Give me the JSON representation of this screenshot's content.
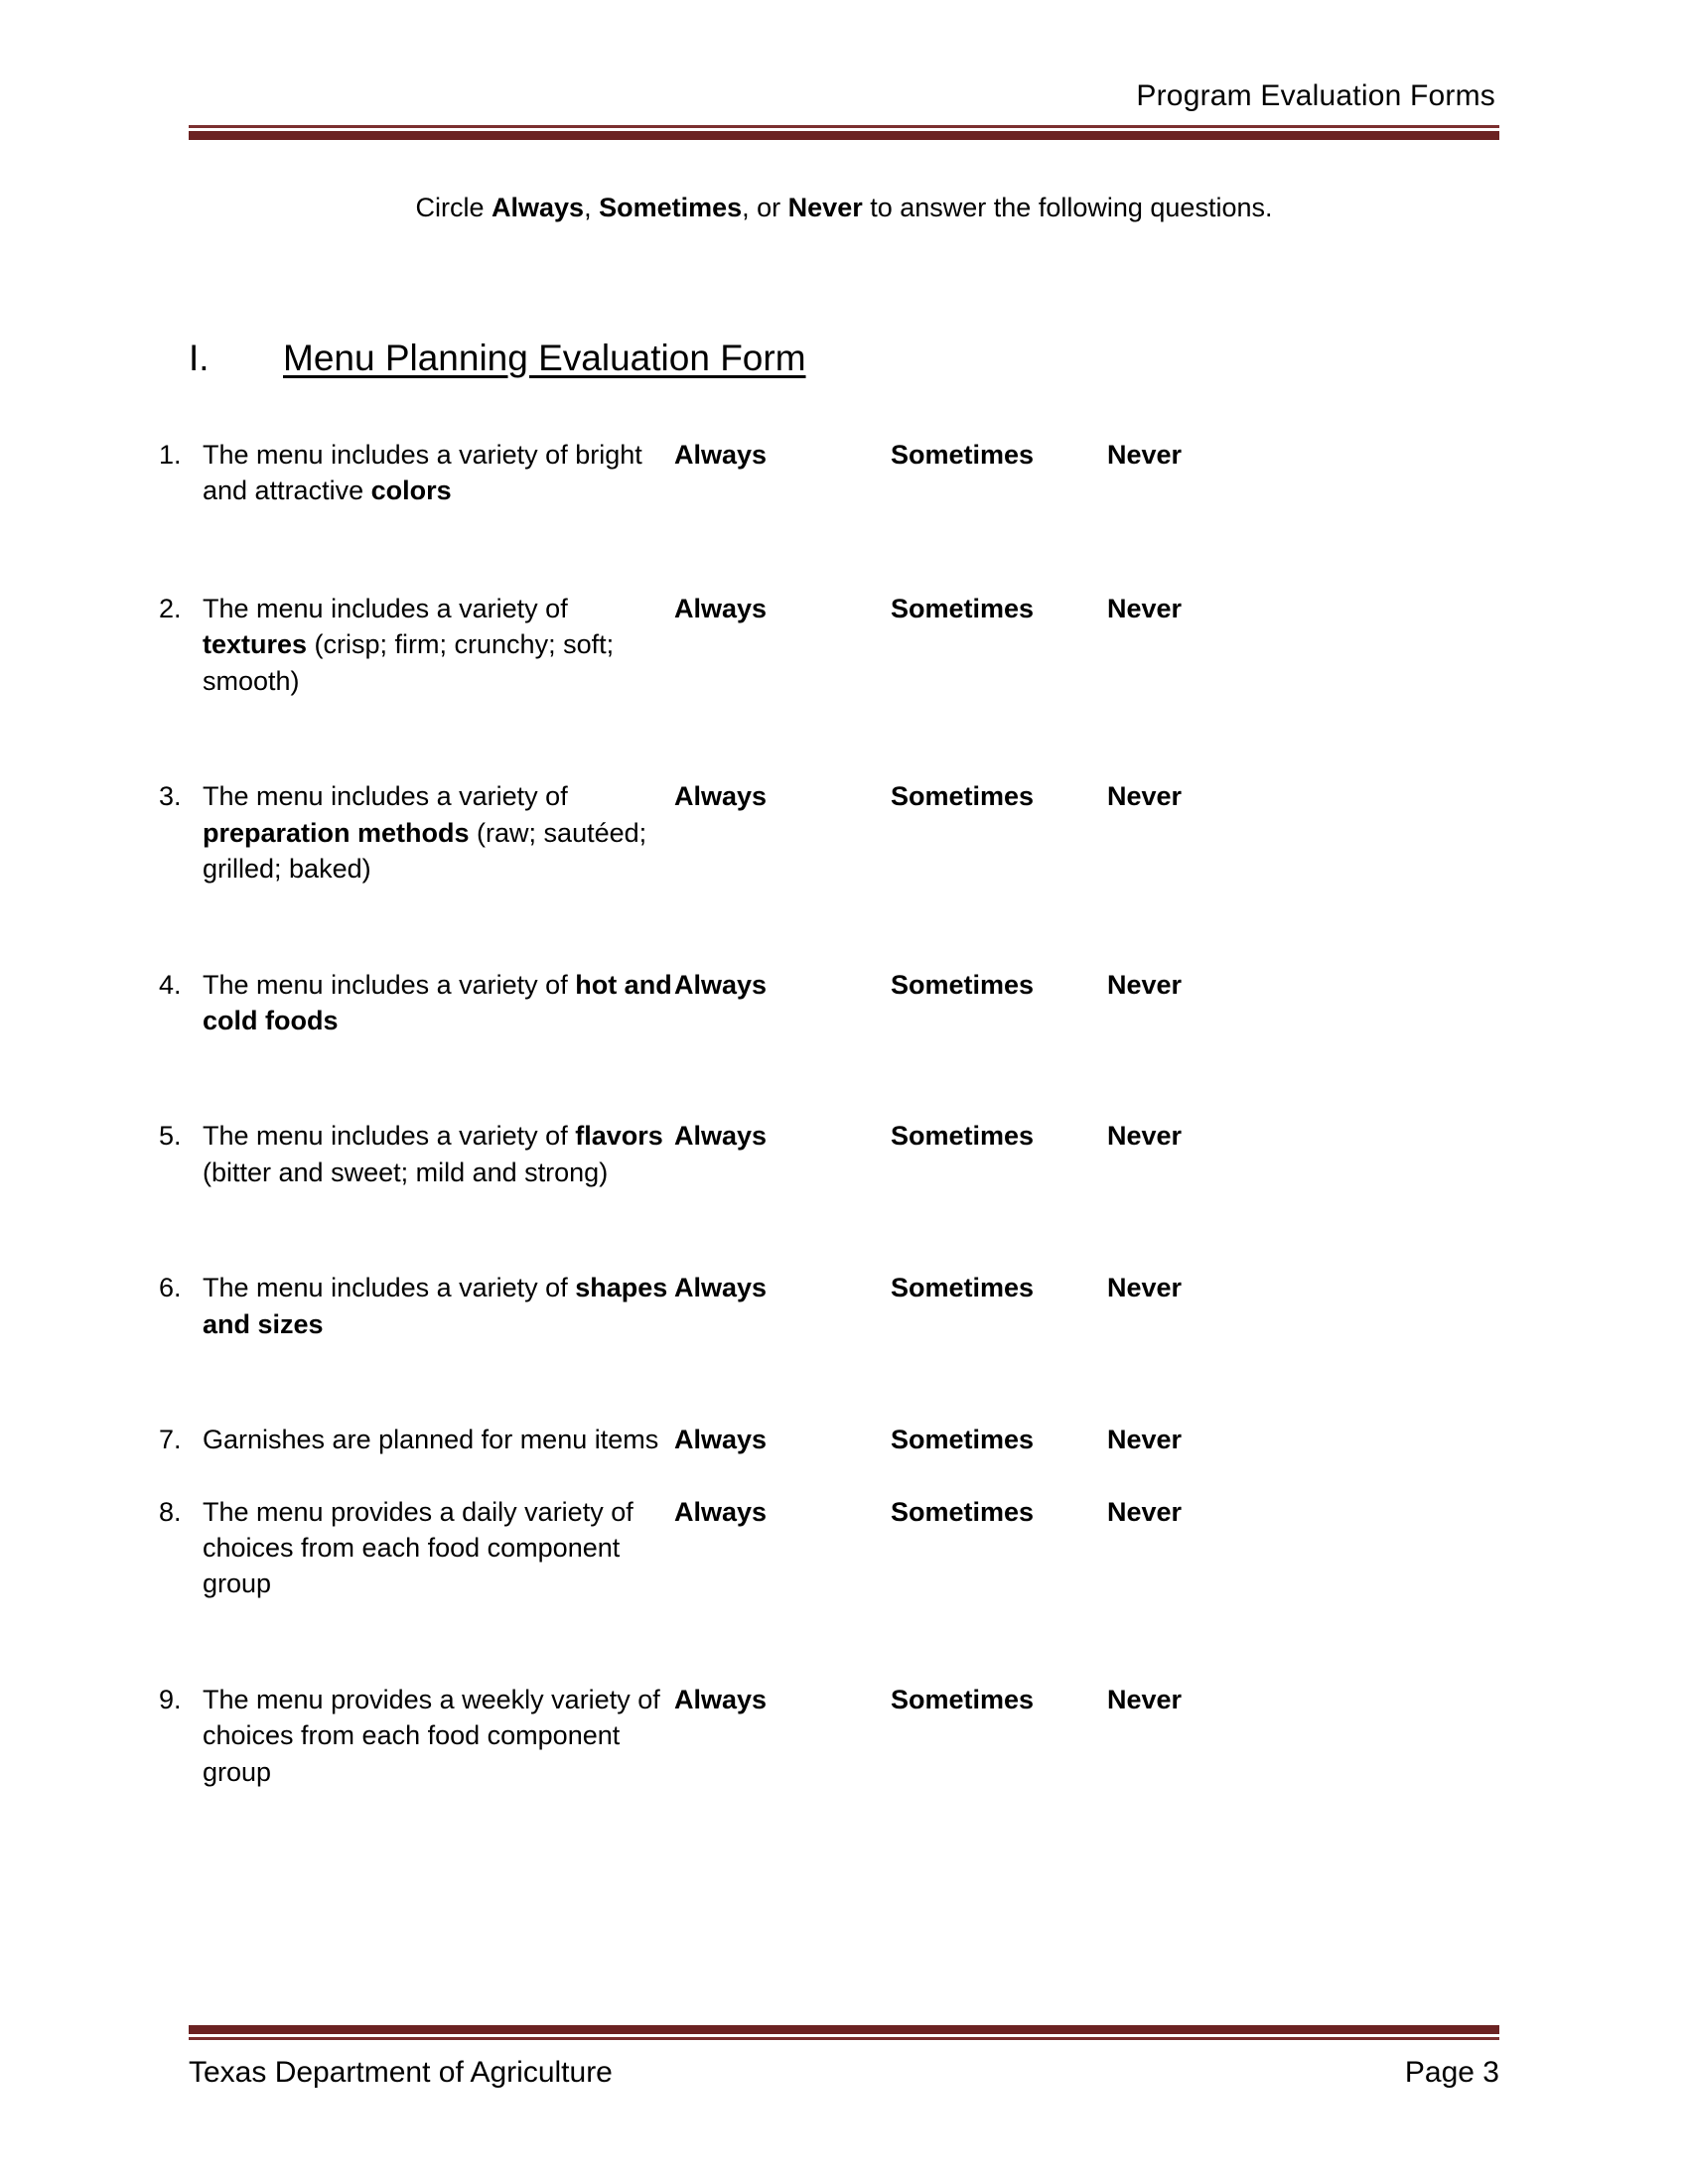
{
  "header": {
    "title": "Program Evaluation Forms"
  },
  "instruction": {
    "before": "Circle ",
    "opt1": "Always",
    "sep1": ", ",
    "opt2": "Sometimes",
    "sep2": ", or ",
    "opt3": "Never",
    "after": " to answer the following questions."
  },
  "section": {
    "number": "I.",
    "title": "Menu Planning Evaluation Form"
  },
  "options": {
    "always": "Always",
    "sometimes": "Sometimes",
    "never": "Never"
  },
  "questions": [
    {
      "number": "1.",
      "parts": [
        {
          "text": "The menu includes a variety of bright and attractive ",
          "bold": false
        },
        {
          "text": "colors",
          "bold": true
        }
      ],
      "plain": "The menu includes a variety of bright and attractive colors"
    },
    {
      "number": "2.",
      "parts": [
        {
          "text": "The menu includes a variety of ",
          "bold": false
        },
        {
          "text": "textures",
          "bold": true
        },
        {
          "text": " (crisp; firm; crunchy; soft; smooth)",
          "bold": false
        }
      ],
      "plain": "The menu includes a variety of textures (crisp; firm; crunchy; soft; smooth)"
    },
    {
      "number": "3.",
      "parts": [
        {
          "text": "The menu includes a variety of ",
          "bold": false
        },
        {
          "text": "preparation methods",
          "bold": true
        },
        {
          "text": " (raw; sautéed; grilled; baked)",
          "bold": false
        }
      ],
      "plain": "The menu includes a variety of preparation methods (raw; sautéed; grilled; baked)"
    },
    {
      "number": "4.",
      "parts": [
        {
          "text": "The menu includes a variety of ",
          "bold": false
        },
        {
          "text": "hot and cold foods",
          "bold": true
        }
      ],
      "plain": "The menu includes a variety of hot and cold foods"
    },
    {
      "number": "5.",
      "parts": [
        {
          "text": "The menu includes a variety of ",
          "bold": false
        },
        {
          "text": "flavors",
          "bold": true
        },
        {
          "text": " (bitter and sweet; mild and strong)",
          "bold": false
        }
      ],
      "plain": "The menu includes a variety of flavors (bitter and sweet; mild and strong)"
    },
    {
      "number": "6.",
      "parts": [
        {
          "text": "The menu includes a variety of ",
          "bold": false
        },
        {
          "text": "shapes and sizes",
          "bold": true
        }
      ],
      "plain": "The menu includes a variety of shapes and sizes"
    },
    {
      "number": "7.",
      "parts": [
        {
          "text": "Garnishes are planned for menu items",
          "bold": false
        }
      ],
      "plain": "Garnishes are planned for menu items"
    },
    {
      "number": "8.",
      "parts": [
        {
          "text": "The menu provides a daily variety of choices from each food component group",
          "bold": false
        }
      ],
      "plain": "The menu provides a daily variety of choices from each food component group"
    },
    {
      "number": "9.",
      "parts": [
        {
          "text": "The menu provides a weekly variety of choices from each food component group",
          "bold": false
        }
      ],
      "plain": "The menu provides a weekly variety of choices from each food component group"
    }
  ],
  "footer": {
    "organization": "Texas Department of Agriculture",
    "page": "Page 3"
  },
  "colors": {
    "rule_thick": "#6B2222",
    "rule_thin": "#7B2F2F",
    "text": "#000000",
    "background": "#ffffff"
  }
}
